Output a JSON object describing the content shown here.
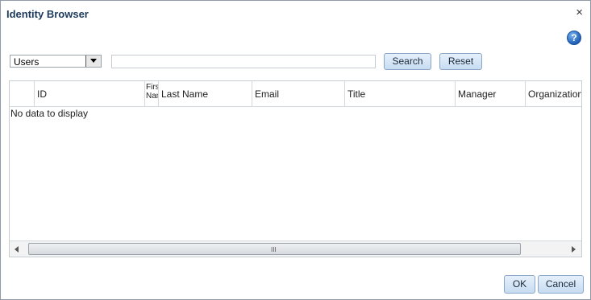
{
  "dialog": {
    "title": "Identity Browser",
    "close_glyph": "×",
    "help_glyph": "?"
  },
  "search": {
    "type_selected": "Users",
    "query_value": "",
    "search_label": "Search",
    "reset_label": "Reset"
  },
  "table": {
    "columns": [
      "",
      "ID",
      "First Name",
      "Last Name",
      "Email",
      "Title",
      "Manager",
      "Organization"
    ],
    "empty_text": "No data to display",
    "scroll_grip": "III"
  },
  "footer": {
    "ok_label": "OK",
    "cancel_label": "Cancel"
  }
}
